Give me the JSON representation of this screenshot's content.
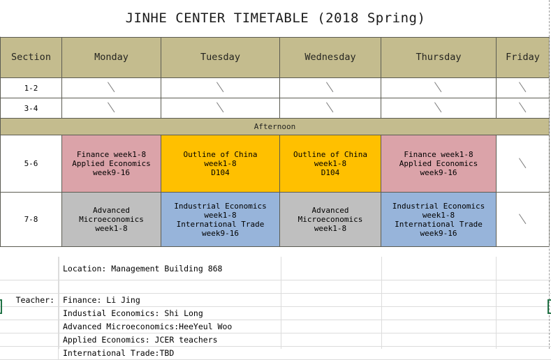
{
  "title": "JINHE CENTER TIMETABLE (2018 Spring)",
  "table": {
    "columns": [
      "Section",
      "Monday",
      "Tuesday",
      "Wednesday",
      "Thursday",
      "Friday"
    ],
    "afternoon_label": "Afternoon",
    "slash_glyph": "/",
    "rows": [
      {
        "section": "1-2",
        "cells": [
          {
            "text": "/",
            "style": "empty"
          },
          {
            "text": "/",
            "style": "empty"
          },
          {
            "text": "/",
            "style": "empty"
          },
          {
            "text": "/",
            "style": "empty"
          },
          {
            "text": "/",
            "style": "empty"
          }
        ]
      },
      {
        "section": "3-4",
        "cells": [
          {
            "text": "/",
            "style": "empty"
          },
          {
            "text": "/",
            "style": "empty"
          },
          {
            "text": "/",
            "style": "empty"
          },
          {
            "text": "/",
            "style": "empty"
          },
          {
            "text": "/",
            "style": "empty"
          }
        ]
      },
      {
        "section": "5-6",
        "cells": [
          {
            "text": "Finance week1-8\nApplied Economics\nweek9-16",
            "style": "pink"
          },
          {
            "text": "Outline of China\nweek1-8\nD104",
            "style": "yellow"
          },
          {
            "text": "Outline of China\nweek1-8\nD104",
            "style": "yellow"
          },
          {
            "text": "Finance week1-8\nApplied Economics\nweek9-16",
            "style": "pink"
          },
          {
            "text": "/",
            "style": "empty"
          }
        ]
      },
      {
        "section": "7-8",
        "cells": [
          {
            "text": "Advanced\nMicroeconomics\nweek1-8",
            "style": "gray"
          },
          {
            "text": "Industrial Economics\nweek1-8\nInternational Trade\nweek9-16",
            "style": "blue"
          },
          {
            "text": "Advanced\nMicroeconomics\nweek1-8",
            "style": "gray"
          },
          {
            "text": "Industrial Economics\nweek1-8\nInternational Trade\nweek9-16",
            "style": "blue"
          },
          {
            "text": "/",
            "style": "empty"
          }
        ]
      }
    ]
  },
  "info": {
    "location": "Location:  Management Building 868",
    "teacher_label": "Teacher:",
    "teachers": [
      "Finance:  Li Jing",
      "Industial Economics: Shi Long",
      "Advanced  Microeconomics:HeeYeul Woo",
      "Applied Economics: JCER teachers",
      "International Trade:TBD"
    ]
  },
  "colors": {
    "header_tan": "#c4bc8e",
    "pink": "#dba3a9",
    "yellow": "#ffc000",
    "gray": "#bfbfbf",
    "blue": "#97b4da",
    "grid_line": "#5c5c52",
    "cell_cursor_green": "#217346"
  }
}
